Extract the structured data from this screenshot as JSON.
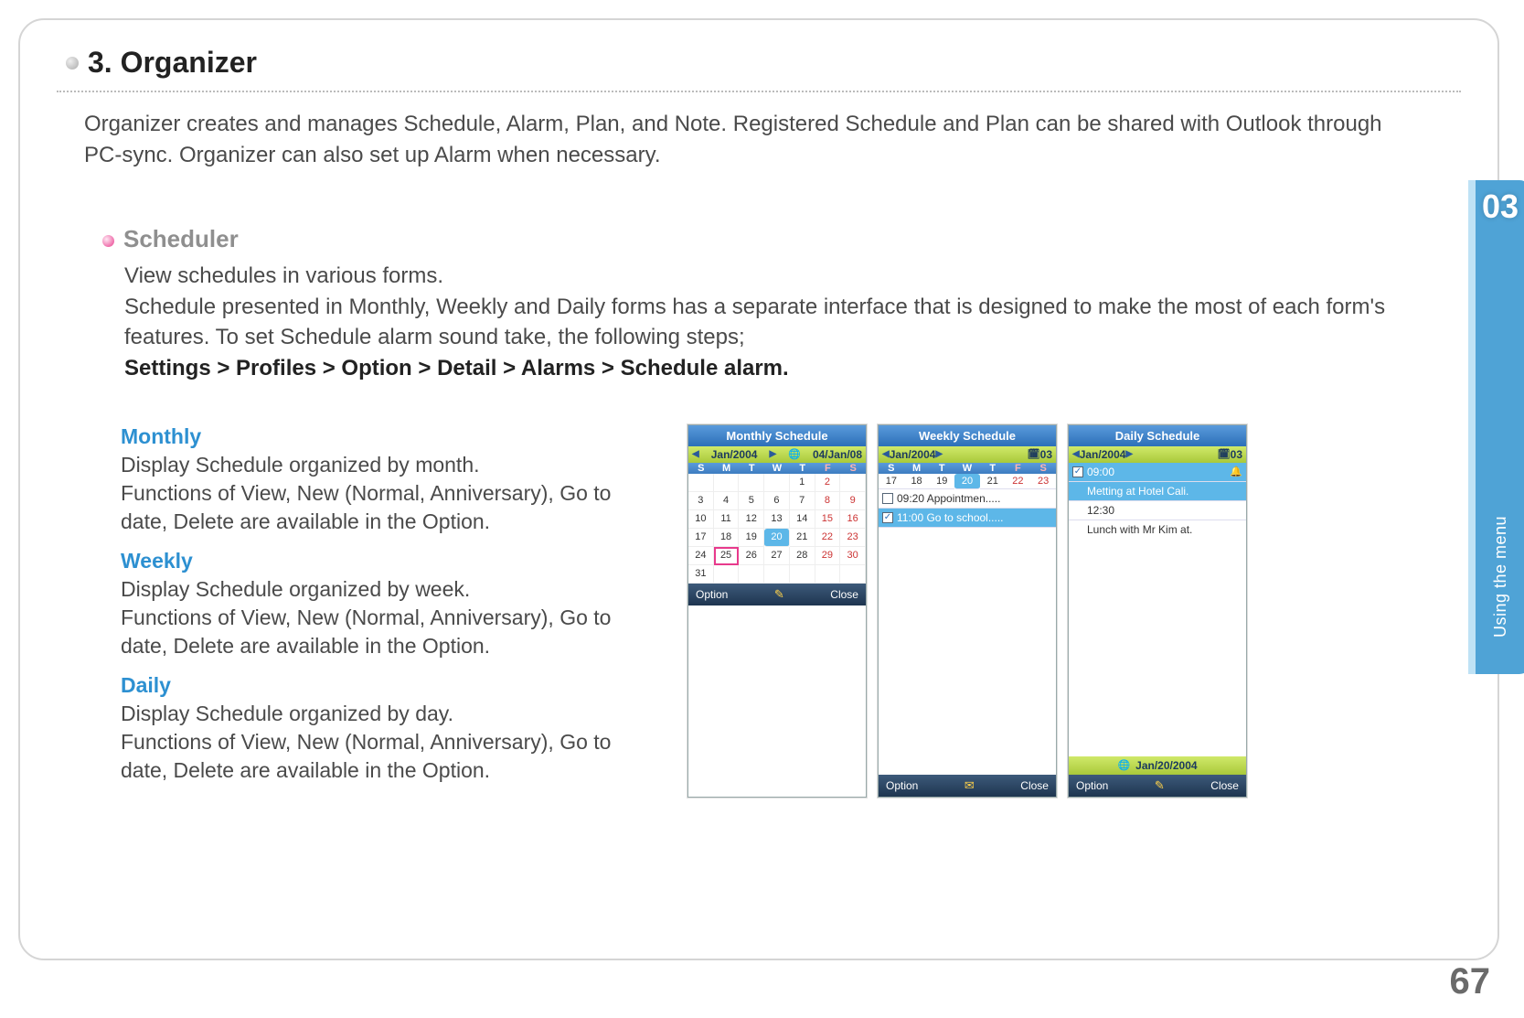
{
  "side": {
    "chapter_num": "03",
    "label": "Using the menu"
  },
  "page_number": "67",
  "title": "3. Organizer",
  "intro": "Organizer creates and manages Schedule, Alarm, Plan, and Note. Registered Schedule and Plan can be shared with Outlook through PC-sync. Organizer can also set up Alarm when necessary.",
  "section": {
    "title": "Scheduler",
    "line1": "View schedules in various forms.",
    "line2": "Schedule presented in Monthly, Weekly and Daily forms has a separate interface that is designed to make the most of each form's features. To set Schedule alarm sound take, the following steps;",
    "path": "Settings > Profiles > Option > Detail > Alarms > Schedule alarm."
  },
  "views": [
    {
      "title": "Monthly",
      "body": "Display Schedule organized by month.\nFunctions of View, New (Normal, Anniversary), Go to date, Delete are available in the Option."
    },
    {
      "title": "Weekly",
      "body": "Display Schedule organized by week.\nFunctions of View, New (Normal, Anniversary), Go to date, Delete are available in the Option."
    },
    {
      "title": "Daily",
      "body": "Display Schedule organized by day.\nFunctions of View, New (Normal, Anniversary), Go to date, Delete are available in the Option."
    }
  ],
  "phones": {
    "dow": [
      "S",
      "M",
      "T",
      "W",
      "T",
      "F",
      "S"
    ],
    "monthly": {
      "title": "Monthly  Schedule",
      "month_nav": "Jan/2004",
      "date_box": "04/Jan/08",
      "option": "Option",
      "close": "Close",
      "selected_day": 20,
      "boxed_day": 25,
      "weeks": [
        [
          "",
          "",
          "",
          "",
          "1",
          "2",
          ""
        ],
        [
          "3",
          "4",
          "5",
          "6",
          "7",
          "8",
          "9"
        ],
        [
          "10",
          "11",
          "12",
          "13",
          "14",
          "15",
          "16"
        ],
        [
          "17",
          "18",
          "19",
          "20",
          "21",
          "22",
          "23"
        ],
        [
          "24",
          "25",
          "26",
          "27",
          "28",
          "29",
          "30"
        ],
        [
          "31",
          "",
          "",
          "",
          "",
          "",
          ""
        ]
      ]
    },
    "weekly": {
      "title": "Weekly  Schedule",
      "month_nav": "Jan/2004",
      "badge": "03",
      "days": [
        "17",
        "18",
        "19",
        "20",
        "21",
        "22",
        "23"
      ],
      "selected_day": "20",
      "items": [
        {
          "checked": false,
          "text": "09:20 Appointmen....."
        },
        {
          "checked": true,
          "text": "11:00 Go to school....."
        }
      ],
      "option": "Option",
      "close": "Close"
    },
    "daily": {
      "title": "Daily  Schedule",
      "month_nav": "Jan/2004",
      "badge": "03",
      "items": [
        {
          "checked": true,
          "time": "09:00",
          "text": "Metting at Hotel Cali.",
          "bell": true,
          "selected": true
        },
        {
          "checked": false,
          "time": "12:30",
          "text": "Lunch with Mr Kim at."
        }
      ],
      "date_strip": "Jan/20/2004",
      "option": "Option",
      "close": "Close"
    }
  }
}
